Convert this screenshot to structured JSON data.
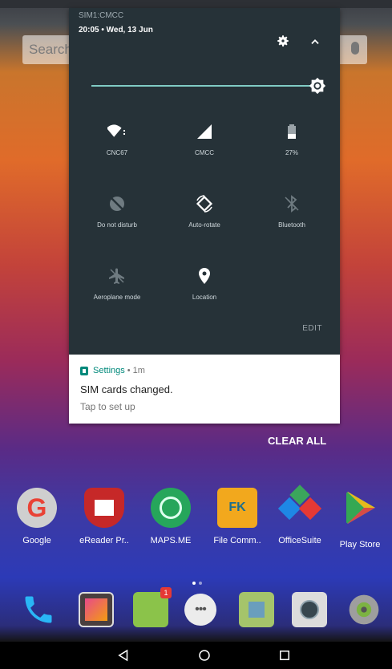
{
  "home": {
    "search_placeholder": "Search"
  },
  "quick_settings": {
    "sim_label": "SIM1:CMCC",
    "datetime": "20:05 • Wed, 13 Jun",
    "brightness_level": 0.95,
    "edit_label": "EDIT",
    "tiles": [
      {
        "label": "CNC67",
        "icon": "wifi-icon",
        "active": true
      },
      {
        "label": "CMCC",
        "icon": "cell-signal-icon",
        "active": true
      },
      {
        "label": "27%",
        "icon": "battery-icon",
        "active": true
      },
      {
        "label": "Do not disturb",
        "icon": "do-not-disturb-icon",
        "active": false
      },
      {
        "label": "Auto-rotate",
        "icon": "auto-rotate-icon",
        "active": true
      },
      {
        "label": "Bluetooth",
        "icon": "bluetooth-icon",
        "active": false
      },
      {
        "label": "Aeroplane mode",
        "icon": "airplane-icon",
        "active": false
      },
      {
        "label": "Location",
        "icon": "location-icon",
        "active": true
      }
    ]
  },
  "notification": {
    "app_name": "Settings",
    "meta": "• 1m",
    "title": "SIM cards changed.",
    "subtitle": "Tap to set up",
    "accent": "#00897b"
  },
  "clear_all_label": "CLEAR ALL",
  "apps": [
    {
      "label": "Google",
      "icon": "google-icon"
    },
    {
      "label": "eReader Pr..",
      "icon": "ereader-icon"
    },
    {
      "label": "MAPS.ME",
      "icon": "maps-me-icon"
    },
    {
      "label": "File Comm..",
      "icon": "file-commander-icon"
    },
    {
      "label": "OfficeSuite",
      "icon": "officesuite-icon"
    },
    {
      "label": "Play Store",
      "icon": "play-store-icon"
    }
  ],
  "dock": [
    {
      "icon": "phone-icon"
    },
    {
      "icon": "gallery-icon"
    },
    {
      "icon": "messaging-icon",
      "badge": "1"
    },
    {
      "icon": "app-drawer-icon"
    },
    {
      "icon": "maps-icon"
    },
    {
      "icon": "camera-icon"
    },
    {
      "icon": "settings-icon"
    }
  ],
  "navigation": {
    "back": "back-icon",
    "home": "home-icon",
    "recents": "recents-icon"
  }
}
